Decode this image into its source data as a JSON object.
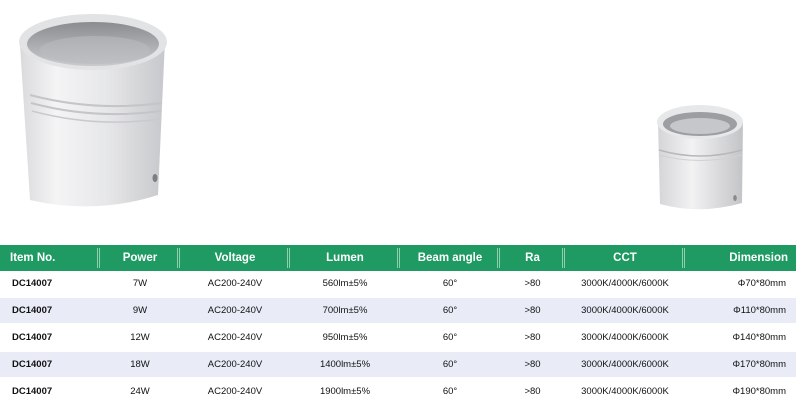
{
  "table": {
    "headers": [
      "Item No.",
      "Power",
      "Voltage",
      "Lumen",
      "Beam angle",
      "Ra",
      "CCT",
      "Dimension"
    ],
    "rows": [
      [
        "DC14007",
        "7W",
        "AC200-240V",
        "560lm±5%",
        "60°",
        ">80",
        "3000K/4000K/6000K",
        "Φ70*80mm"
      ],
      [
        "DC14007",
        "9W",
        "AC200-240V",
        "700lm±5%",
        "60°",
        ">80",
        "3000K/4000K/6000K",
        "Φ110*80mm"
      ],
      [
        "DC14007",
        "12W",
        "AC200-240V",
        "950lm±5%",
        "60°",
        ">80",
        "3000K/4000K/6000K",
        "Φ140*80mm"
      ],
      [
        "DC14007",
        "18W",
        "AC200-240V",
        "1400lm±5%",
        "60°",
        ">80",
        "3000K/4000K/6000K",
        "Φ170*80mm"
      ],
      [
        "DC14007",
        "24W",
        "AC200-240V",
        "1900lm±5%",
        "60°",
        ">80",
        "3000K/4000K/6000K",
        "Φ190*80mm"
      ]
    ]
  },
  "colors": {
    "header_bg": "#1f9a63",
    "header_text": "#ffffff",
    "row_shade": "#e9ecf7"
  }
}
